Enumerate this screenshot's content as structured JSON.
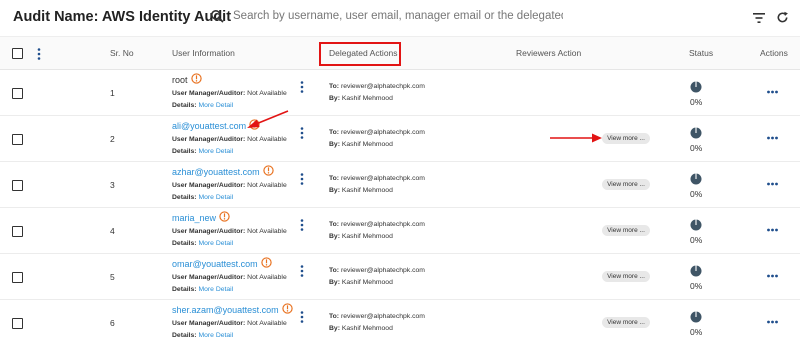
{
  "header": {
    "title": "Audit Name: AWS Identity Audit",
    "search_placeholder": "Search by username, user email, manager email or the delegated to..."
  },
  "columns": {
    "sr_no": "Sr. No",
    "user_info": "User Information",
    "delegated": "Delegated Actions",
    "reviewers": "Reviewers Action",
    "status": "Status",
    "actions": "Actions"
  },
  "labels": {
    "manager": "User Manager/Auditor:",
    "details": "Details:",
    "to": "To:",
    "by": "By:"
  },
  "rows": [
    {
      "sr": "1",
      "name": "root",
      "is_link": false,
      "manager": "Not Available",
      "details_link": "More Detail",
      "to": "reviewer@alphatechpk.com",
      "by": "Kashif Mehmood",
      "view_more": "",
      "status": "0%"
    },
    {
      "sr": "2",
      "name": "ali@youattest.com",
      "is_link": true,
      "manager": "Not Available",
      "details_link": "More Detail",
      "to": "reviewer@alphatechpk.com",
      "by": "Kashif Mehmood",
      "view_more": "View more ...",
      "status": "0%"
    },
    {
      "sr": "3",
      "name": "azhar@youattest.com",
      "is_link": true,
      "manager": "Not Available",
      "details_link": "More Detail",
      "to": "reviewer@alphatechpk.com",
      "by": "Kashif Mehmood",
      "view_more": "View more ...",
      "status": "0%"
    },
    {
      "sr": "4",
      "name": "maria_new",
      "is_link": true,
      "manager": "Not Available",
      "details_link": "More Detail",
      "to": "reviewer@alphatechpk.com",
      "by": "Kashif Mehmood",
      "view_more": "View more ...",
      "status": "0%"
    },
    {
      "sr": "5",
      "name": "omar@youattest.com",
      "is_link": true,
      "manager": "Not Available",
      "details_link": "More Detail",
      "to": "reviewer@alphatechpk.com",
      "by": "Kashif Mehmood",
      "view_more": "View more ...",
      "status": "0%"
    },
    {
      "sr": "6",
      "name": "sher.azam@youattest.com",
      "is_link": true,
      "manager": "Not Available",
      "details_link": "More Detail",
      "to": "reviewer@alphatechpk.com",
      "by": "Kashif Mehmood",
      "view_more": "View more ...",
      "status": "0%"
    }
  ],
  "colors": {
    "link": "#2a8fd6",
    "info_icon": "#e8711f",
    "annotation": "#e21414",
    "status_pie": "#3f5566",
    "kebab": "#1f4e8c"
  },
  "icons": {
    "search": "search-icon",
    "filter": "filter-icon",
    "refresh": "refresh-icon",
    "info": "info-icon",
    "kebab": "kebab-icon",
    "status": "status-pie-icon",
    "actions": "more-horizontal-icon"
  }
}
